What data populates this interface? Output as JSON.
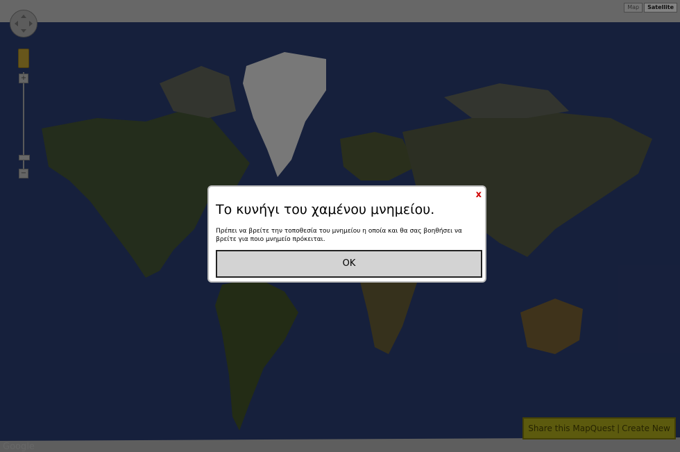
{
  "map": {
    "type_buttons": [
      "Map",
      "Satellite"
    ],
    "active_type": "Satellite",
    "zoom_in_label": "+",
    "zoom_out_label": "−",
    "provider_logo": "Google"
  },
  "share_bar": {
    "share_label": "Share this MapQuest",
    "separator": "|",
    "create_label": "Create New"
  },
  "dialog": {
    "close_label": "x",
    "title": "Το κυνήγι του χαμένου μνημείου.",
    "body": "Πρέπει να βρείτε την τοποθεσία του μνημείου η οποία και θα σας βοηθήσει να βρείτε για ποιο μνημείο πρόκειται.",
    "ok_label": "OK"
  },
  "colors": {
    "ocean": "#1b2647",
    "dialog_close": "#d00000",
    "share_bar": "#6d6a11"
  },
  "icons": [
    "pan-control-icon",
    "pegman-icon"
  ]
}
